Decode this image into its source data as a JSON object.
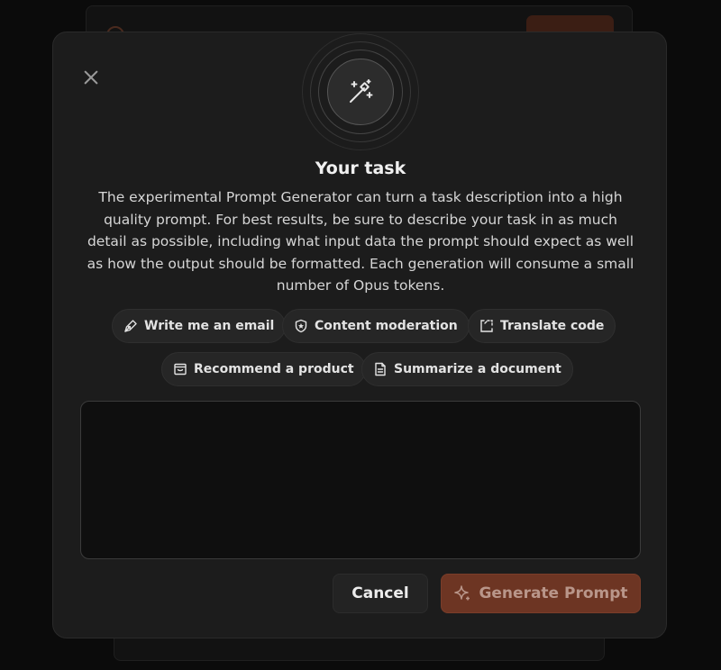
{
  "modal": {
    "title": "Your task",
    "description": "The experimental Prompt Generator can turn a task description into a high quality prompt. For best results, be sure to describe your task in as much detail as possible, including what input data the prompt should expect as well as how the output should be formatted. Each generation will consume a small number of Opus tokens.",
    "examples": [
      {
        "label": "Write me an email",
        "icon": "pen-icon"
      },
      {
        "label": "Content moderation",
        "icon": "shield-icon"
      },
      {
        "label": "Translate code",
        "icon": "code-bracket-icon"
      },
      {
        "label": "Recommend a product",
        "icon": "storefront-icon"
      },
      {
        "label": "Summarize a document",
        "icon": "document-icon"
      }
    ],
    "task_input": {
      "value": "",
      "placeholder": ""
    },
    "buttons": {
      "cancel": "Cancel",
      "generate": "Generate Prompt"
    }
  },
  "colors": {
    "accent": "#6d3523",
    "modal_bg": "#1c1c1c"
  }
}
